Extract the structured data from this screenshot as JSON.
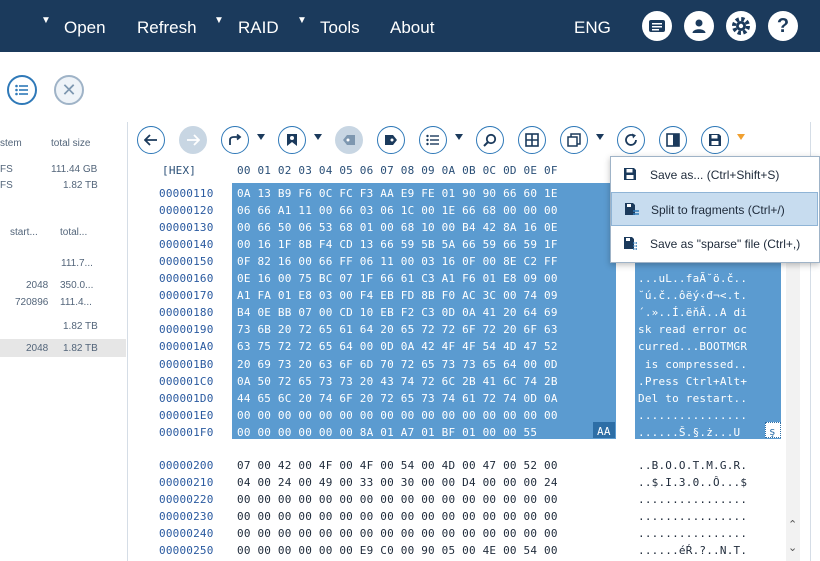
{
  "menu": {
    "open": "Open",
    "refresh": "Refresh",
    "raid": "RAID",
    "tools": "Tools",
    "about": "About",
    "language": "ENG"
  },
  "left_panel": {
    "col_system": "stem",
    "col_total": "total size",
    "rows1": [
      {
        "fs": "FS",
        "size": "111.44 GB"
      },
      {
        "fs": "FS",
        "size": "1.82 TB"
      }
    ],
    "col_start": "start...",
    "col_total2": "total...",
    "rows2": [
      {
        "start": "",
        "total": "111.7..."
      },
      {
        "start": "2048",
        "total": "350.0..."
      },
      {
        "start": "720896",
        "total": "111.4..."
      },
      {
        "start": "",
        "total": "1.82 TB"
      },
      {
        "start": "2048",
        "total": "1.82 TB"
      }
    ]
  },
  "hex": {
    "label": "[HEX]",
    "columns": "00 01 02 03 04 05 06 07 08 09 0A 0B 0C 0D 0E 0F",
    "offsets_selected": [
      "00000110",
      "00000120",
      "00000130",
      "00000140",
      "00000150",
      "00000160",
      "00000170",
      "00000180",
      "00000190",
      "000001A0",
      "000001B0",
      "000001C0",
      "000001D0",
      "000001E0",
      "000001F0"
    ],
    "bytes_selected": [
      "0A 13 B9 F6 0C FC F3 AA E9 FE 01 90 90 66 60 1E",
      "06 66 A1 11 00 66 03 06 1C 00 1E 66 68 00 00 00",
      "00 66 50 06 53 68 01 00 68 10 00 B4 42 8A 16 0E",
      "00 16 1F 8B F4 CD 13 66 59 5B 5A 66 59 66 59 1F",
      "0F 82 16 00 66 FF 06 11 00 03 16 0F 00 8E C2 FF",
      "0E 16 00 75 BC 07 1F 66 61 C3 A1 F6 01 E8 09 00",
      "A1 FA 01 E8 03 00 F4 EB FD 8B F0 AC 3C 00 74 09",
      "B4 0E BB 07 00 CD 10 EB F2 C3 0D 0A 41 20 64 69",
      "73 6B 20 72 65 61 64 20 65 72 72 6F 72 20 6F 63",
      "63 75 72 72 65 64 00 0D 0A 42 4F 4F 54 4D 47 52",
      "20 69 73 20 63 6F 6D 70 72 65 73 73 65 64 00 0D",
      "0A 50 72 65 73 73 20 43 74 72 6C 2B 41 6C 74 2B",
      "44 65 6C 20 74 6F 20 72 65 73 74 61 72 74 0D 0A",
      "00 00 00 00 00 00 00 00 00 00 00 00 00 00 00 00",
      "00 00 00 00 00 00 8A 01 A7 01 BF 01 00 00 55"
    ],
    "last_byte": "AA",
    "ascii_selected": [
      "",
      "",
      "",
      "",
      "",
      "...uL..faÃ˘ö.č..",
      "˘ú.č..ôëý‹đ¬<.t.",
      "´.»..Í.ëňĂ..A di",
      "sk read error oc",
      "curred...BOOTMGR",
      " is compressed..",
      ".Press Ctrl+Alt+",
      "Del to restart..",
      "................",
      "......Š.§.ż...U"
    ],
    "ascii_last_char": "ş",
    "offsets_normal": [
      "00000200",
      "00000210",
      "00000220",
      "00000230",
      "00000240",
      "00000250"
    ],
    "bytes_normal": [
      "07 00 42 00 4F 00 4F 00 54 00 4D 00 47 00 52 00",
      "04 00 24 00 49 00 33 00 30 00 00 D4 00 00 00 24",
      "00 00 00 00 00 00 00 00 00 00 00 00 00 00 00 00",
      "00 00 00 00 00 00 00 00 00 00 00 00 00 00 00 00",
      "00 00 00 00 00 00 00 00 00 00 00 00 00 00 00 00",
      "00 00 00 00 00 00 E9 C0 00 90 05 00 4E 00 54 00"
    ],
    "ascii_normal": [
      "..B.O.O.T.M.G.R.",
      "..$.I.3.0..Ô...$",
      "................",
      "................",
      "................",
      "......éŔ.?..N.T."
    ]
  },
  "save_menu": {
    "items": [
      {
        "label": "Save as... (Ctrl+Shift+S)"
      },
      {
        "label": "Split to fragments (Ctrl+/)"
      },
      {
        "label": "Save as \"sparse\" file (Ctrl+,)"
      }
    ]
  },
  "colors": {
    "topbar": "#1b3a5c",
    "accent": "#2f79b8",
    "selection": "#5b9bd0",
    "menu_highlight": "#c7dcef"
  }
}
